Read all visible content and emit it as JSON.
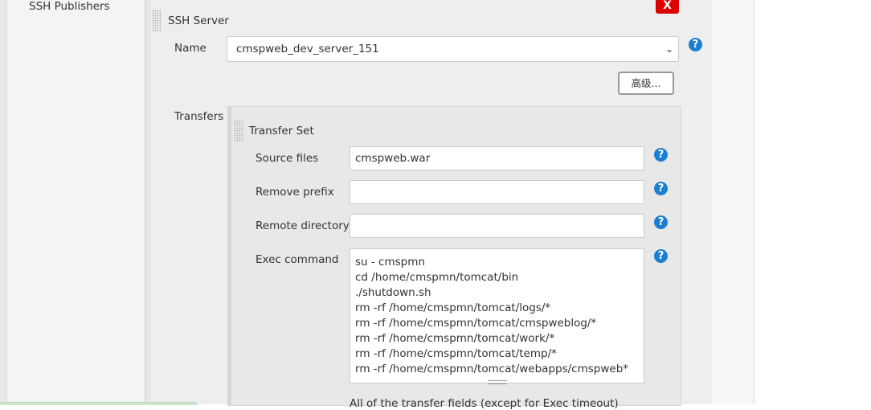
{
  "sidebar": {
    "section_label": "SSH Publishers"
  },
  "server": {
    "title": "SSH Server",
    "delete_label": "X",
    "name_label": "Name",
    "name_value": "cmspweb_dev_server_151",
    "advanced_label": "高级...",
    "transfers_label": "Transfers",
    "help": "?"
  },
  "transfer_set": {
    "title": "Transfer Set",
    "source_files_label": "Source files",
    "source_files_value": "cmspweb.war",
    "remove_prefix_label": "Remove prefix",
    "remove_prefix_value": "",
    "remote_directory_label": "Remote directory",
    "remote_directory_value": "",
    "exec_command_label": "Exec command",
    "exec_command_value": "su - cmspmn\ncd /home/cmspmn/tomcat/bin\n./shutdown.sh\nrm -rf /home/cmspmn/tomcat/logs/*\nrm -rf /home/cmspmn/tomcat/cmspweblog/*\nrm -rf /home/cmspmn/tomcat/work/*\nrm -rf /home/cmspmn/tomcat/temp/*\nrm -rf /home/cmspmn/tomcat/webapps/cmspweb*",
    "note": "All of the transfer fields (except for Exec timeout)"
  }
}
